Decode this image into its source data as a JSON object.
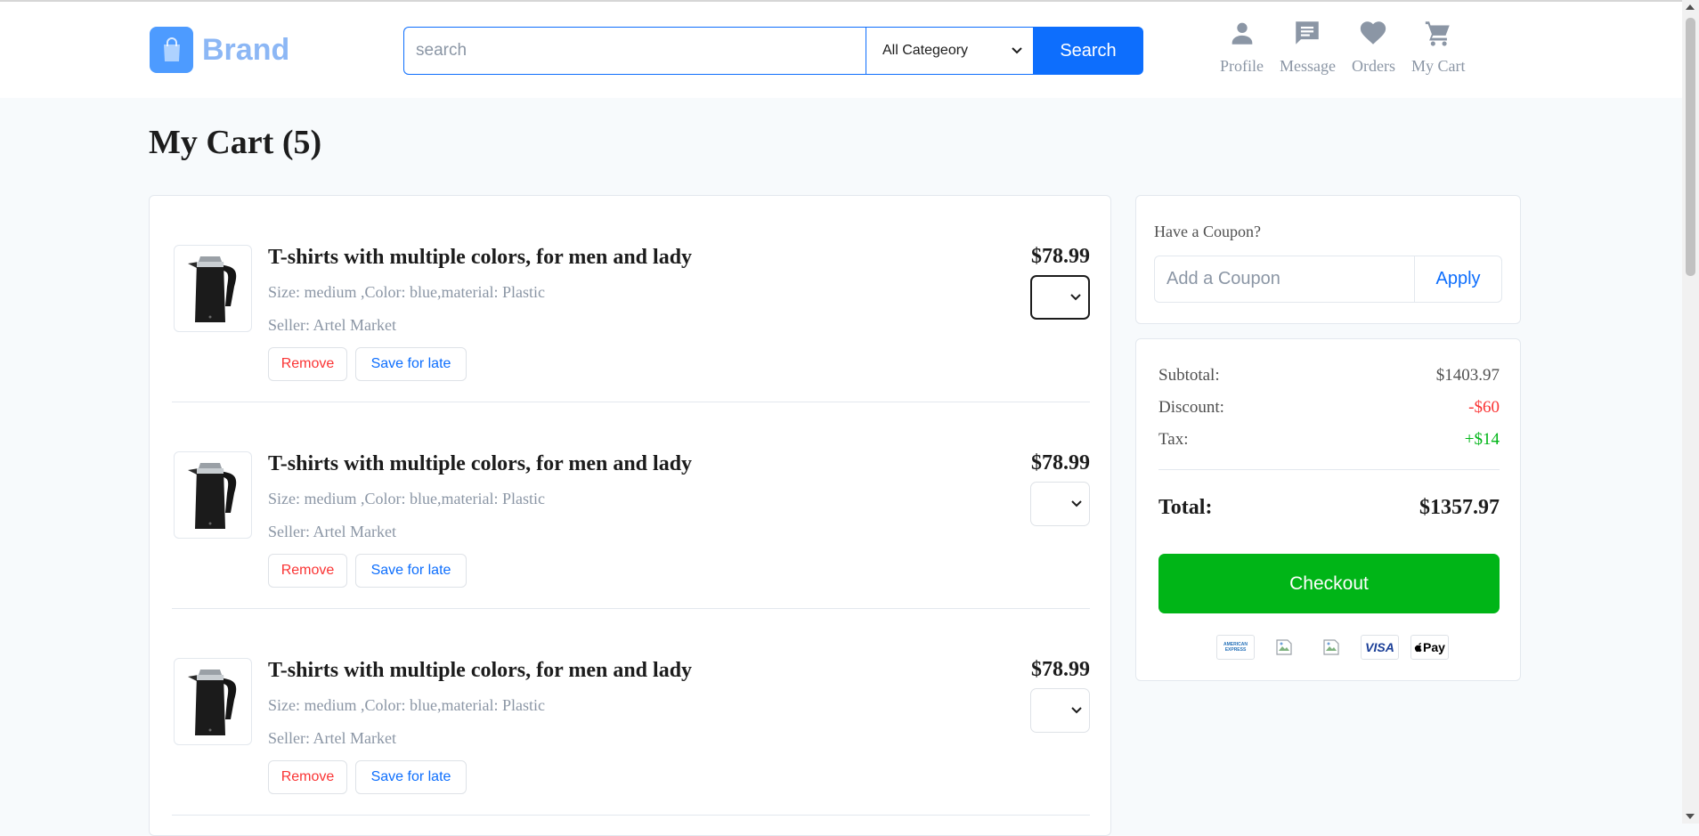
{
  "header": {
    "brand": "Brand",
    "search_placeholder": "search",
    "category": "All Categeory",
    "search_button": "Search",
    "nav": {
      "profile": "Profile",
      "message": "Message",
      "orders": "Orders",
      "cart": "My Cart"
    }
  },
  "page": {
    "title": "My Cart (5)"
  },
  "cart": {
    "items": [
      {
        "title": "T-shirts with multiple colors, for men and lady",
        "meta": "Size: medium ,Color: blue,material: Plastic",
        "seller": "Seller: Artel Market",
        "price": "$78.99",
        "remove": "Remove",
        "save": "Save for late"
      },
      {
        "title": "T-shirts with multiple colors, for men and lady",
        "meta": "Size: medium ,Color: blue,material: Plastic",
        "seller": "Seller: Artel Market",
        "price": "$78.99",
        "remove": "Remove",
        "save": "Save for late"
      },
      {
        "title": "T-shirts with multiple colors, for men and lady",
        "meta": "Size: medium ,Color: blue,material: Plastic",
        "seller": "Seller: Artel Market",
        "price": "$78.99",
        "remove": "Remove",
        "save": "Save for late"
      }
    ]
  },
  "coupon": {
    "label": "Have a Coupon?",
    "placeholder": "Add a Coupon",
    "apply": "Apply"
  },
  "summary": {
    "subtotal_label": "Subtotal:",
    "subtotal": "$1403.97",
    "discount_label": "Discount:",
    "discount": "-$60",
    "tax_label": "Tax:",
    "tax": "+$14",
    "total_label": "Total:",
    "total": "$1357.97",
    "checkout": "Checkout"
  },
  "payments": {
    "amex_text": "AMERICAN EXPRESS",
    "visa": "VISA",
    "apple_pay": "Pay"
  },
  "colors": {
    "primary": "#0d6efd",
    "success": "#00b517",
    "danger": "#fa3434",
    "muted": "#8b96a5"
  }
}
